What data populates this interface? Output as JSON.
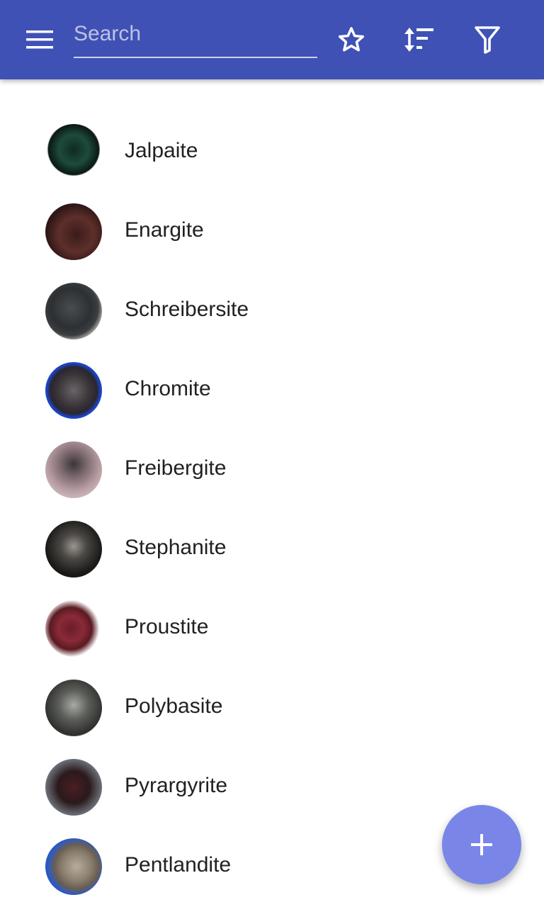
{
  "header": {
    "search_placeholder": "Search",
    "accent": "#3f51b5"
  },
  "fab": {
    "icon": "plus-icon",
    "color": "#7986e8"
  },
  "minerals": [
    {
      "name": "Jalpaite"
    },
    {
      "name": "Enargite"
    },
    {
      "name": "Schreibersite"
    },
    {
      "name": "Chromite"
    },
    {
      "name": "Freibergite"
    },
    {
      "name": "Stephanite"
    },
    {
      "name": "Proustite"
    },
    {
      "name": "Polybasite"
    },
    {
      "name": "Pyrargyrite"
    },
    {
      "name": "Pentlandite"
    }
  ]
}
